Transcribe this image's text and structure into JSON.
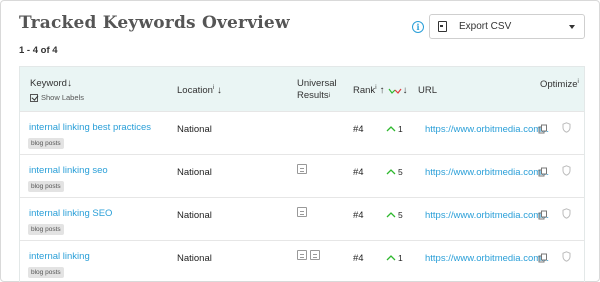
{
  "header": {
    "title": "Tracked Keywords Overview",
    "count": "1 - 4 of 4",
    "info_icon": "info-icon",
    "export_label": "Export CSV"
  },
  "columns": {
    "keyword": "Keyword",
    "keyword_arrow": "↓",
    "show_labels": "Show Labels",
    "location": "Location",
    "location_sup": "i",
    "location_arrow": "↓",
    "universal_line1": "Universal",
    "universal_line2": "Results",
    "universal_sup": "i",
    "rank": "Rank",
    "rank_sup": "i",
    "rank_arrow": "↑",
    "change_arrow": "↓",
    "url": "URL",
    "optimize": "Optimize",
    "optimize_sup": "i"
  },
  "rows": [
    {
      "keyword": "internal linking best practices",
      "tag": "blog posts",
      "location": "National",
      "universal_results": 0,
      "rank": "#4",
      "change": "1",
      "url": "https://www.orbitmedia.com..."
    },
    {
      "keyword": "internal linking seo",
      "tag": "blog posts",
      "location": "National",
      "universal_results": 1,
      "rank": "#4",
      "change": "5",
      "url": "https://www.orbitmedia.com..."
    },
    {
      "keyword": "internal linking SEO",
      "tag": "blog posts",
      "location": "National",
      "universal_results": 1,
      "rank": "#4",
      "change": "5",
      "url": "https://www.orbitmedia.com..."
    },
    {
      "keyword": "internal linking",
      "tag": "blog posts",
      "location": "National",
      "universal_results": 2,
      "rank": "#4",
      "change": "1",
      "url": "https://www.orbitmedia.com..."
    }
  ],
  "colors": {
    "link": "#2a9fd8",
    "header_bg": "#eaf5f4",
    "trend_up": "#2eb82e",
    "trend_down": "#e03c3c"
  }
}
